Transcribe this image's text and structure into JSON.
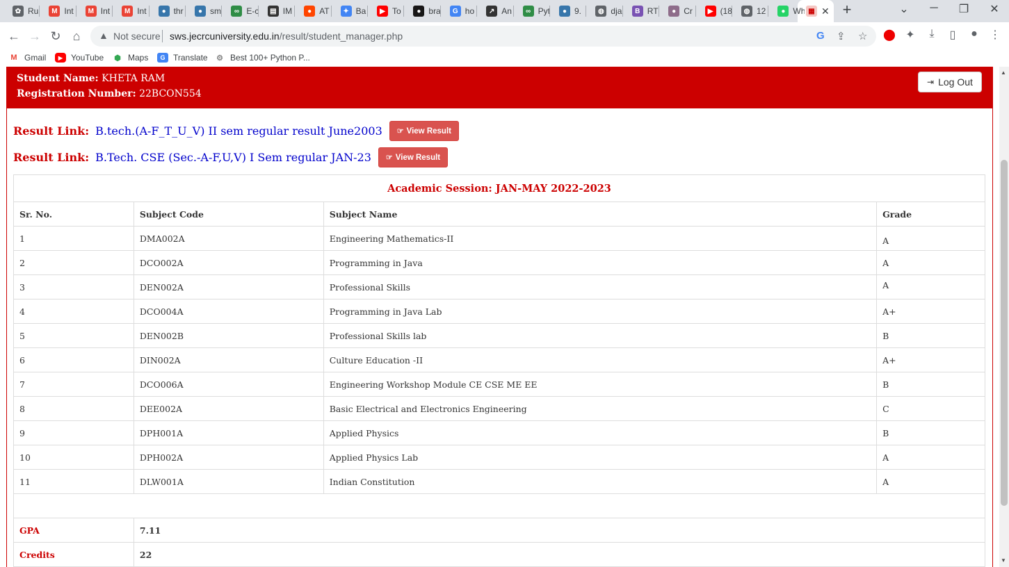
{
  "browser": {
    "tabs": [
      {
        "label": "Ru",
        "icon": "openai-icon",
        "color": "#5f6368"
      },
      {
        "label": "Int",
        "icon": "gmail-icon",
        "color": "#ea4335"
      },
      {
        "label": "Int",
        "icon": "gmail-icon",
        "color": "#ea4335"
      },
      {
        "label": "Int",
        "icon": "gmail-icon",
        "color": "#ea4335"
      },
      {
        "label": "thr",
        "icon": "python-icon",
        "color": "#3776ab"
      },
      {
        "label": "sm",
        "icon": "python-icon",
        "color": "#3776ab"
      },
      {
        "label": "E-c",
        "icon": "geeksforgeeks-icon",
        "color": "#2f8d46"
      },
      {
        "label": "IM",
        "icon": "imdb-icon",
        "color": "#333333"
      },
      {
        "label": "AT",
        "icon": "reddit-icon",
        "color": "#ff4500"
      },
      {
        "label": "Ba",
        "icon": "bard-icon",
        "color": "#4285f4"
      },
      {
        "label": "To",
        "icon": "youtube-icon",
        "color": "#ff0000"
      },
      {
        "label": "bra",
        "icon": "github-icon",
        "color": "#181717"
      },
      {
        "label": "ho",
        "icon": "google-icon",
        "color": "#4285f4"
      },
      {
        "label": "An",
        "icon": "chart-icon",
        "color": "#333333"
      },
      {
        "label": "Pyt",
        "icon": "geeksforgeeks-icon",
        "color": "#2f8d46"
      },
      {
        "label": "9.",
        "icon": "python-icon",
        "color": "#3776ab"
      },
      {
        "label": "dja",
        "icon": "globe-icon",
        "color": "#5f6368"
      },
      {
        "label": "RT",
        "icon": "bootstrap-icon",
        "color": "#7952b3"
      },
      {
        "label": "Cr",
        "icon": "avatar-icon",
        "color": "#8e6c8a"
      },
      {
        "label": "(18",
        "icon": "youtube-icon",
        "color": "#ff0000"
      },
      {
        "label": "12",
        "icon": "globe-icon",
        "color": "#5f6368"
      },
      {
        "label": "Wh",
        "icon": "whatsapp-icon",
        "color": "#25d366"
      }
    ],
    "active_tab_icon": "university-icon",
    "new_tab": "+",
    "omnibox": {
      "security_label": "Not secure",
      "domain": "sws.jecrcuniversity.edu.in",
      "path": "/result/student_manager.php"
    },
    "bookmarks": [
      {
        "label": "Gmail",
        "icon": "gmail-icon"
      },
      {
        "label": "YouTube",
        "icon": "youtube-icon"
      },
      {
        "label": "Maps",
        "icon": "maps-icon"
      },
      {
        "label": "Translate",
        "icon": "translate-icon"
      },
      {
        "label": "Best 100+ Python P...",
        "icon": "bookmark-site-icon"
      }
    ]
  },
  "student": {
    "name_label": "Student Name:",
    "name": "KHETA RAM",
    "reg_label": "Registration Number:",
    "reg": "22BCON554",
    "logout_label": "Log Out"
  },
  "results": [
    {
      "label": "Result Link:",
      "title": "B.tech.(A-F_T_U_V) II sem regular result June2003",
      "button": "View Result"
    },
    {
      "label": "Result Link:",
      "title": "B.Tech. CSE (Sec.-A-F,U,V) I Sem regular JAN-23",
      "button": "View Result"
    }
  ],
  "table": {
    "session": "Academic Session:  JAN-MAY 2022-2023",
    "headers": [
      "Sr. No.",
      "Subject Code",
      "Subject Name",
      "Grade"
    ],
    "rows": [
      [
        "1",
        "DMA002A",
        "Engineering Mathematics-II",
        "A"
      ],
      [
        "2",
        "DCO002A",
        "Programming in Java",
        "A"
      ],
      [
        "3",
        "DEN002A",
        "Professional Skills",
        "A"
      ],
      [
        "4",
        "DCO004A",
        "Programming in Java Lab",
        "A+"
      ],
      [
        "5",
        "DEN002B",
        "Professional Skills lab",
        "B"
      ],
      [
        "6",
        "DIN002A",
        "Culture Education -II",
        "A+"
      ],
      [
        "7",
        "DCO006A",
        "Engineering Workshop Module CE CSE ME EE",
        "B"
      ],
      [
        "8",
        "DEE002A",
        "Basic Electrical and Electronics Engineering",
        "C"
      ],
      [
        "9",
        "DPH001A",
        "Applied Physics",
        "B"
      ],
      [
        "10",
        "DPH002A",
        "Applied Physics Lab",
        "A"
      ],
      [
        "11",
        "DLW001A",
        "Indian Constitution",
        "A"
      ]
    ],
    "gpa_label": "GPA",
    "gpa": "7.11",
    "credits_label": "Credits",
    "credits": "22"
  },
  "colors": {
    "brand_red": "#cc0000",
    "link_blue": "#0000cc",
    "button_red": "#d9534f"
  }
}
